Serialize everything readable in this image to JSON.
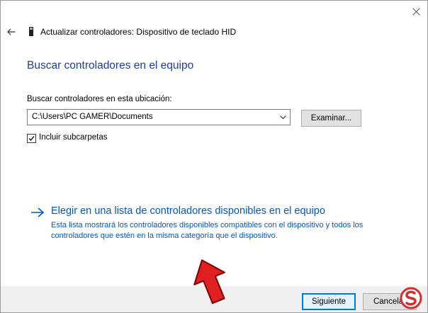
{
  "window": {
    "title": "Actualizar controladores: Dispositivo de teclado HID",
    "close_icon": "close-icon",
    "back_icon": "back-arrow-icon",
    "device_icon": "keyboard-device-icon"
  },
  "main": {
    "heading": "Buscar controladores en el equipo",
    "location_label": "Buscar controladores en esta ubicación:",
    "path_value": "C:\\Users\\PC GAMER\\Documents",
    "browse_label": "Examinar...",
    "include_subfolders_label": "Incluir subcarpetas",
    "include_subfolders_checked": true,
    "pick_title": "Elegir en una lista de controladores disponibles en el equipo",
    "pick_description": "Esta lista mostrará los controladores disponibles compatibles con el dispositivo y todos los controladores que estén en la misma categoría que el dispositivo."
  },
  "footer": {
    "next_label": "Siguiente",
    "cancel_label": "Cancelar"
  },
  "overlay": {
    "annotation_icon": "red-up-arrow-icon",
    "watermark_icon": "solvetic-logo-icon"
  },
  "colors": {
    "heading": "#1a3e9c",
    "link": "#0056c8",
    "primary_border": "#0078d7",
    "annotation": "#e02020"
  }
}
